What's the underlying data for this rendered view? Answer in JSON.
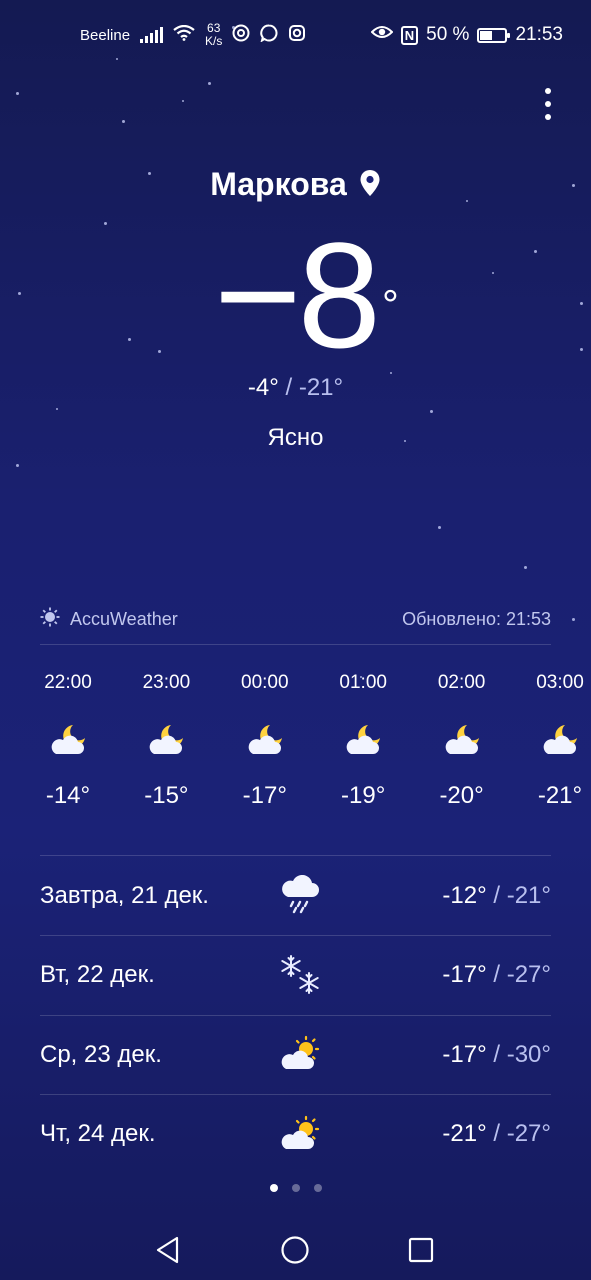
{
  "status_bar": {
    "carrier": "Beeline",
    "net_speed_value": "63",
    "net_speed_unit": "K/s",
    "battery_percent": "50 %",
    "battery_level": 0.5,
    "time": "21:53"
  },
  "location": {
    "city": "Маркова"
  },
  "current": {
    "temperature": "−8",
    "degree_symbol": "°",
    "high": "-4°",
    "separator": " / ",
    "low": "-21°",
    "condition": "Ясно"
  },
  "source": {
    "provider": "AccuWeather",
    "updated": "Обновлено: 21:53"
  },
  "hourly": [
    {
      "time": "22:00",
      "temp": "-14°",
      "icon": "moon-cloud-icon"
    },
    {
      "time": "23:00",
      "temp": "-15°",
      "icon": "moon-cloud-icon"
    },
    {
      "time": "00:00",
      "temp": "-17°",
      "icon": "moon-cloud-icon"
    },
    {
      "time": "01:00",
      "temp": "-19°",
      "icon": "moon-cloud-icon"
    },
    {
      "time": "02:00",
      "temp": "-20°",
      "icon": "moon-cloud-icon"
    },
    {
      "time": "03:00",
      "temp": "-21°",
      "icon": "moon-cloud-icon"
    }
  ],
  "daily": [
    {
      "day": "Завтра, 21 дек.",
      "high": "-12°",
      "separator": " / ",
      "low": "-21°",
      "icon": "rain-cloud-icon"
    },
    {
      "day": "Вт, 22 дек.",
      "high": "-17°",
      "separator": " / ",
      "low": "-27°",
      "icon": "snowflake-icon"
    },
    {
      "day": "Ср, 23 дек.",
      "high": "-17°",
      "separator": " / ",
      "low": "-30°",
      "icon": "sun-cloud-icon"
    },
    {
      "day": "Чт, 24 дек.",
      "high": "-21°",
      "separator": " / ",
      "low": "-27°",
      "icon": "sun-cloud-icon"
    }
  ],
  "pager": {
    "count": 3,
    "active_index": 0
  },
  "colors": {
    "background_top": "#141a52",
    "background_mid": "#1b2277",
    "moon": "#ffd23f",
    "sun": "#ffc21a",
    "muted_text": "#b9c0ef"
  }
}
